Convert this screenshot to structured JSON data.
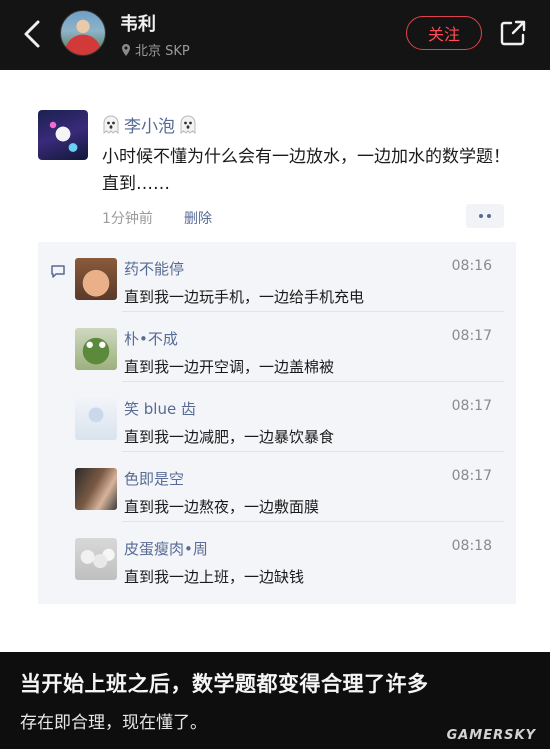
{
  "header": {
    "username": "韦利",
    "location": "北京 SKP",
    "follow_label": "关注",
    "icons": [
      "back-arrow-icon",
      "location-pin-icon",
      "share-icon"
    ]
  },
  "post": {
    "author": "李小泡",
    "author_icon": "ghost-emoji-icon",
    "text": "小时候不懂为什么会有一边放水，一边加水的数学题！直到……",
    "time": "1分钟前",
    "delete_label": "删除",
    "more_icon": "more-dots-icon"
  },
  "comments": [
    {
      "name": "药不能停",
      "time": "08:16",
      "text": "直到我一边玩手机，一边给手机充电"
    },
    {
      "name": "朴•不成",
      "time": "08:17",
      "text": "直到我一边开空调，一边盖棉被"
    },
    {
      "name": "笑 blue 齿",
      "time": "08:17",
      "text": "直到我一边减肥，一边暴饮暴食"
    },
    {
      "name": "色即是空",
      "time": "08:17",
      "text": "直到我一边熬夜，一边敷面膜"
    },
    {
      "name": "皮蛋瘦肉•周",
      "time": "08:18",
      "text": "直到我一边上班，一边缺钱"
    }
  ],
  "caption": {
    "line1": "当开始上班之后，数学题都变得合理了许多",
    "line2": "存在即合理，现在懂了。",
    "watermark": "GAMERSKY"
  },
  "colors": {
    "accent_red": "#e0404b",
    "link_blue": "#576b95",
    "background_dark": "#121212"
  }
}
